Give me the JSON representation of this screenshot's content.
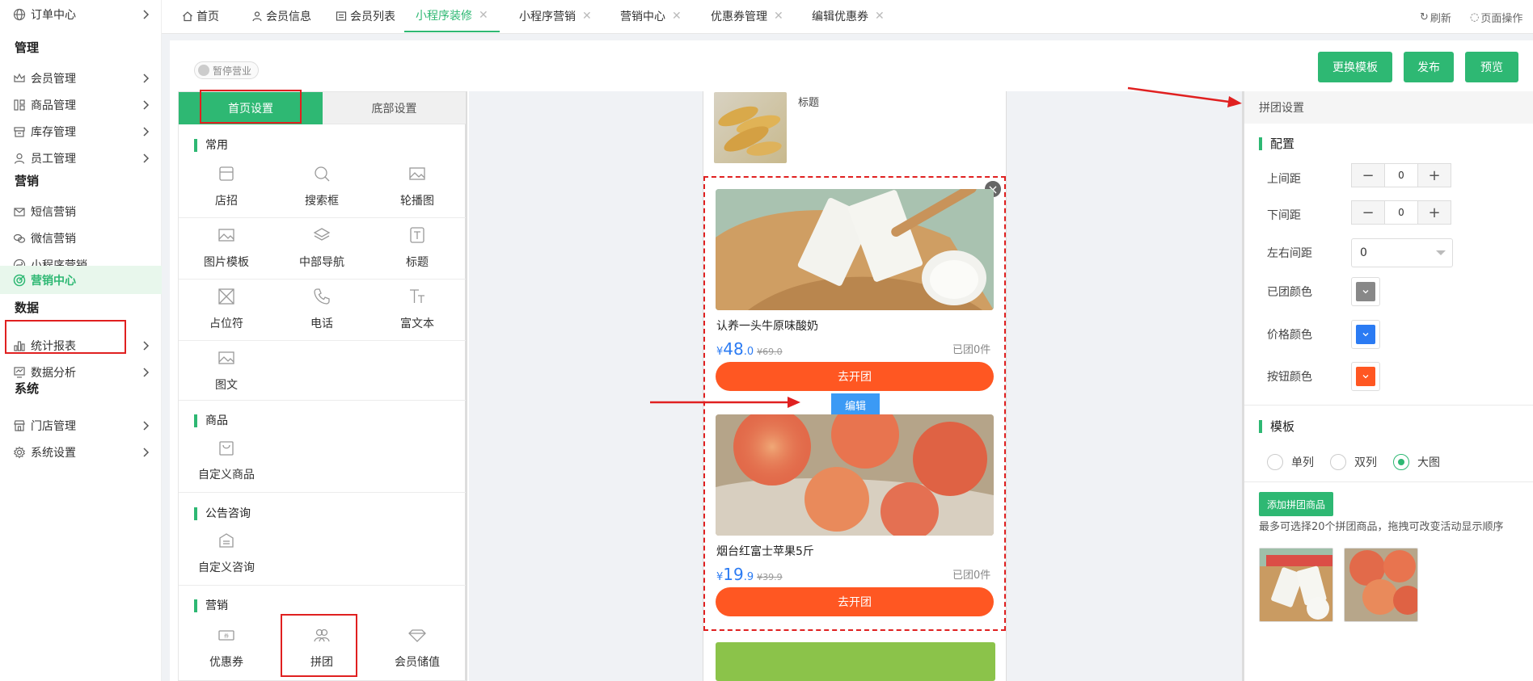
{
  "sidebar": {
    "top_item": "订单中心",
    "groups": [
      "管理",
      "营销",
      "数据",
      "系统"
    ],
    "items": {
      "member": "会员管理",
      "goods": "商品管理",
      "stock": "库存管理",
      "staff": "员工管理",
      "sms": "短信营销",
      "wechat": "微信营销",
      "mini": "小程序营销",
      "center": "营销中心",
      "report": "统计报表",
      "analysis": "数据分析",
      "store": "门店管理",
      "settings": "系统设置"
    }
  },
  "tabs": [
    "首页",
    "会员信息",
    "会员列表",
    "小程序装修",
    "小程序营销",
    "营销中心",
    "优惠券管理",
    "编辑优惠券"
  ],
  "tab_actions": {
    "refresh": "刷新",
    "page_ops": "页面操作"
  },
  "toolbar": {
    "pause": "暂停营业",
    "change_template": "更换模板",
    "publish": "发布",
    "preview": "预览"
  },
  "left_panel": {
    "tab_home": "首页设置",
    "tab_bottom": "底部设置",
    "sections": {
      "common": "常用",
      "goods": "商品",
      "notice": "公告咨询",
      "marketing": "营销"
    },
    "common_items": [
      "店招",
      "搜索框",
      "轮播图",
      "图片模板",
      "中部导航",
      "标题",
      "占位符",
      "电话",
      "富文本",
      "图文"
    ],
    "goods_items": [
      "自定义商品"
    ],
    "notice_items": [
      "自定义咨询"
    ],
    "marketing_items": [
      "优惠券",
      "拼团",
      "会员储值"
    ]
  },
  "preview": {
    "fish_title": "标题",
    "products": [
      {
        "name": "认养一头牛原味酸奶",
        "currency": "¥",
        "price_int": "48",
        "price_dec": ".0",
        "orig": "¥69.0",
        "joined": "已团0件",
        "button": "去开团"
      },
      {
        "name": "烟台红富士苹果5斤",
        "currency": "¥",
        "price_int": "19",
        "price_dec": ".9",
        "orig": "¥39.9",
        "joined": "已团0件",
        "button": "去开团"
      }
    ],
    "edit": "编辑"
  },
  "settings": {
    "header": "拼团设置",
    "config_title": "配置",
    "top_margin_label": "上间距",
    "top_margin": "0",
    "bottom_margin_label": "下间距",
    "bottom_margin": "0",
    "side_margin_label": "左右间距",
    "side_margin": "0",
    "grouped_color_label": "已团颜色",
    "price_color_label": "价格颜色",
    "button_color_label": "按钮颜色",
    "template_title": "模板",
    "templates": [
      "单列",
      "双列",
      "大图"
    ],
    "selected_template": "大图",
    "add_button": "添加拼团商品",
    "hint": "最多可选择20个拼团商品，拖拽可改变活动显示顺序"
  },
  "colors": {
    "accent": "#2eb873",
    "grouped": "#888888",
    "price": "#2b7bf3",
    "button": "#ff5722",
    "highlight": "#e02020"
  }
}
